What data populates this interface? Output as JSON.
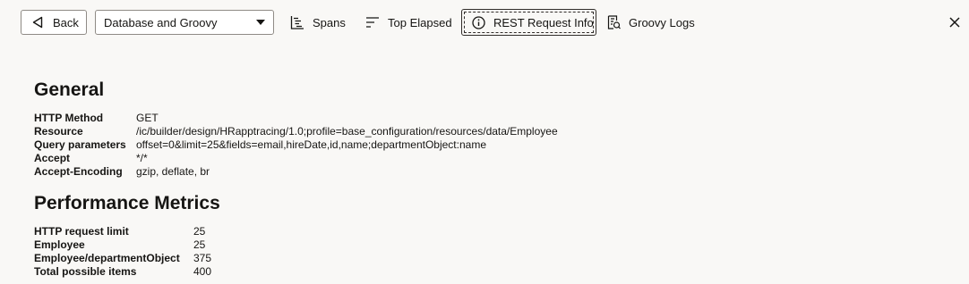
{
  "toolbar": {
    "back_label": "Back",
    "filter_select": {
      "selected": "Database and Groovy"
    },
    "spans_label": "Spans",
    "top_elapsed_label": "Top Elapsed",
    "rest_request_info_label": "REST Request Info",
    "groovy_logs_label": "Groovy Logs"
  },
  "general": {
    "heading": "General",
    "rows": [
      {
        "key": "HTTP Method",
        "value": "GET"
      },
      {
        "key": "Resource",
        "value": "/ic/builder/design/HRapptracing/1.0;profile=base_configuration/resources/data/Employee"
      },
      {
        "key": "Query parameters",
        "value": "offset=0&limit=25&fields=email,hireDate,id,name;departmentObject:name"
      },
      {
        "key": "Accept",
        "value": "*/*"
      },
      {
        "key": "Accept-Encoding",
        "value": "gzip, deflate, br"
      }
    ]
  },
  "performance": {
    "heading": "Performance Metrics",
    "rows": [
      {
        "key": "HTTP request limit",
        "value": "25"
      },
      {
        "key": "Employee",
        "value": "25"
      },
      {
        "key": "Employee/departmentObject",
        "value": "375"
      },
      {
        "key": "Total possible items",
        "value": "400"
      }
    ]
  }
}
